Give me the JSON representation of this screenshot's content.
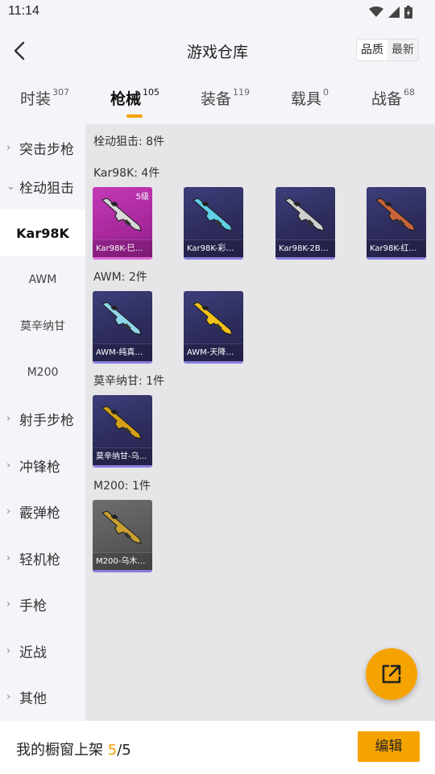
{
  "status_bar": {
    "time": "11:14"
  },
  "header": {
    "title": "游戏仓库",
    "sort_options": [
      "品质",
      "最新"
    ],
    "sort_selected": "品质"
  },
  "tabs": [
    {
      "label": "时装",
      "count": "307"
    },
    {
      "label": "枪械",
      "count": "105",
      "active": true
    },
    {
      "label": "装备",
      "count": "119"
    },
    {
      "label": "载具",
      "count": "0"
    },
    {
      "label": "战备",
      "count": "68"
    }
  ],
  "sidebar": {
    "categories": [
      {
        "label": "突击步枪"
      },
      {
        "label": "栓动狙击",
        "expanded": true
      },
      {
        "label": "Kar98K",
        "sub": true,
        "selected": true
      },
      {
        "label": "AWM",
        "sub": true
      },
      {
        "label": "莫辛纳甘",
        "sub": true
      },
      {
        "label": "M200",
        "sub": true
      },
      {
        "label": "射手步枪"
      },
      {
        "label": "冲锋枪"
      },
      {
        "label": "霰弹枪"
      },
      {
        "label": "轻机枪"
      },
      {
        "label": "手枪"
      },
      {
        "label": "近战"
      },
      {
        "label": "其他"
      }
    ]
  },
  "content": {
    "total_label": "栓动狙击: 8件",
    "sections": [
      {
        "label": "Kar98K: 4件",
        "items": [
          {
            "name": "Kar98K-巳巳...",
            "level": "5级",
            "style": "pink",
            "gun_color": "#d9d9d9"
          },
          {
            "name": "Kar98K-彩虹...",
            "style": "purple",
            "gun_color": "#5fd0e8"
          },
          {
            "name": "Kar98K-2B战...",
            "style": "purple",
            "gun_color": "#cfcfcf"
          },
          {
            "name": "Kar98K-红色...",
            "style": "purple",
            "gun_color": "#c8643a"
          }
        ]
      },
      {
        "label": "AWM: 2件",
        "items": [
          {
            "name": "AWM-纯真浪花",
            "style": "purple",
            "gun_color": "#8fd6ea"
          },
          {
            "name": "AWM-天降萌叽",
            "style": "purple",
            "gun_color": "#f2c21a"
          }
        ]
      },
      {
        "label": "莫辛纳甘: 1件",
        "items": [
          {
            "name": "莫辛纳甘-乌...",
            "style": "purple",
            "gun_color": "#d4a017"
          }
        ]
      },
      {
        "label": "M200: 1件",
        "items": [
          {
            "name": "M200-乌木金...",
            "style": "grey",
            "gun_color": "#caa030"
          }
        ]
      }
    ]
  },
  "bottom_bar": {
    "prefix": "我的橱窗上架 ",
    "shown": "5",
    "total": "/5",
    "edit_label": "编辑"
  },
  "colors": {
    "accent": "#f5a300",
    "card_purple": "#2d2c5c",
    "card_pink": "#b52fa9"
  }
}
